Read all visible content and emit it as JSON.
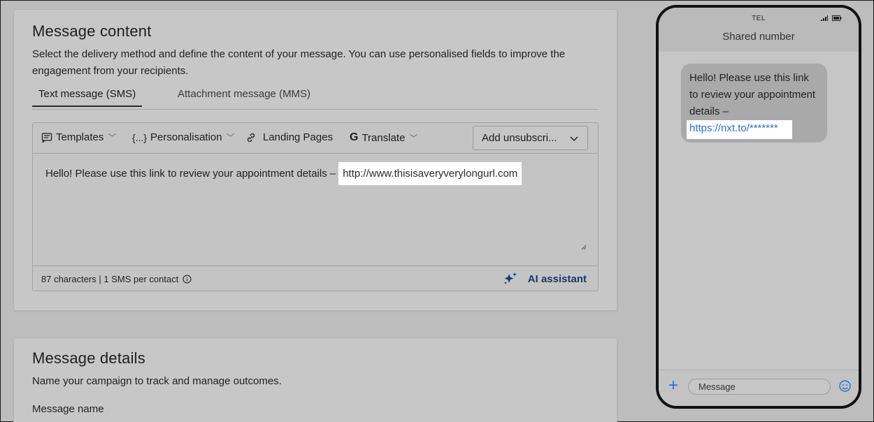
{
  "message_content": {
    "title": "Message content",
    "description": "Select the delivery method and define the content of your message. You can use personalised fields to improve the engagement from your recipients.",
    "tabs": [
      {
        "label": "Text message (SMS)",
        "active": true
      },
      {
        "label": "Attachment message (MMS)",
        "active": false
      }
    ],
    "toolbar": {
      "templates": "Templates",
      "personalisation": "Personalisation",
      "landing_pages": "Landing Pages",
      "translate": "Translate",
      "unsubscribe": "Add unsubscri..."
    },
    "message_text": "Hello! Please use this link to review your appointment details –",
    "message_url": "http://www.thisisaveryverylongurl.com",
    "char_count": "87 characters | 1 SMS per contact",
    "ai_assistant": "AI assistant"
  },
  "message_details": {
    "title": "Message details",
    "description": "Name your campaign to track and manage outcomes.",
    "name_label": "Message name"
  },
  "phone_preview": {
    "carrier": "TEL",
    "header": "Shared number",
    "bubble_text": "Hello! Please use this link to review your appointment details –",
    "bubble_link": "https://nxt.to/*******",
    "input_placeholder": "Message"
  },
  "colors": {
    "page_bg": "#bdbdbd",
    "card_bg": "#c7c7c7",
    "link": "#2a73d9",
    "ai_text": "#143a6b"
  }
}
